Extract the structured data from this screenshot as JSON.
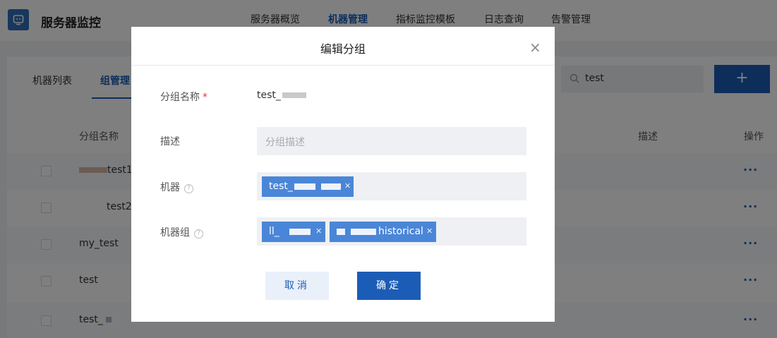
{
  "app": {
    "title": "服务器监控"
  },
  "nav": [
    {
      "label": "服务器概览",
      "active": false
    },
    {
      "label": "机器管理",
      "active": true
    },
    {
      "label": "指标监控模板",
      "active": false
    },
    {
      "label": "日志查询",
      "active": false
    },
    {
      "label": "告警管理",
      "active": false
    }
  ],
  "tabs": [
    {
      "label": "机器列表",
      "active": false
    },
    {
      "label": "组管理",
      "active": true
    }
  ],
  "search": {
    "value": "test"
  },
  "add_button": {
    "label": "+"
  },
  "table": {
    "headers": {
      "name": "分组名称",
      "desc": "描述",
      "ops": "操作"
    },
    "rows": [
      {
        "name": "test1",
        "ops": "···"
      },
      {
        "name": "test2",
        "ops": "···"
      },
      {
        "name": "my_test",
        "ops": "···"
      },
      {
        "name": "test",
        "ops": "···"
      },
      {
        "name": "test_",
        "ops": "···"
      }
    ]
  },
  "modal": {
    "title": "编辑分组",
    "close_icon": "×",
    "fields": {
      "group_name": {
        "label": "分组名称",
        "required_mark": "*",
        "value": "test_"
      },
      "description": {
        "label": "描述",
        "placeholder": "分组描述"
      },
      "machines": {
        "label": "机器",
        "tags": [
          {
            "text": "test_"
          }
        ]
      },
      "machine_groups": {
        "label": "机器组",
        "tags": [
          {
            "text": "ll_"
          },
          {
            "text": "historical"
          }
        ]
      }
    },
    "cancel_label": "取消",
    "ok_label": "确定"
  },
  "colors": {
    "primary": "#1b5db6",
    "tag": "#4a86d8",
    "overlay": "rgba(0,0,0,0.5)"
  }
}
